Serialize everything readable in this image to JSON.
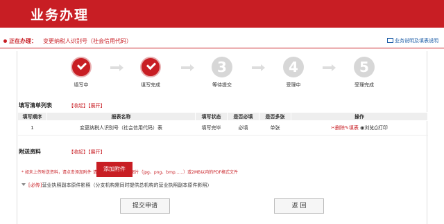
{
  "header": {
    "title": "业务办理"
  },
  "status": {
    "label": "正在办理：",
    "value": "变更纳税人识别号（社会信用代码）",
    "help_link": "业务说明及填表说明"
  },
  "steps": [
    {
      "label": "填写中",
      "state": "done",
      "number": ""
    },
    {
      "label": "填写完成",
      "state": "done",
      "number": ""
    },
    {
      "label": "等待提交",
      "state": "todo",
      "number": "3"
    },
    {
      "label": "受理中",
      "state": "todo",
      "number": "4"
    },
    {
      "label": "受理完成",
      "state": "todo",
      "number": "5"
    }
  ],
  "fill_list": {
    "title": "填写清单列表",
    "collapse": "【收起】",
    "expand": "【展开】",
    "columns": [
      "填写顺序",
      "报表名称",
      "填写状态",
      "是否必填",
      "是否多张",
      "操作"
    ],
    "rows": [
      {
        "order": "1",
        "name": "变更纳税人识别号（社会信用代码）表",
        "status": "填写完毕",
        "required": "必填",
        "multiple": "单张",
        "actions": {
          "delete": "删除",
          "fill": "填表",
          "browse": "浏览",
          "print": "打印"
        }
      }
    ]
  },
  "attachments": {
    "title": "附送资料",
    "collapse": "【收起】",
    "expand": "【展开】",
    "note": "* 如未上传附送资料，请点击添加附件 请上传500kb以内的图片（jpg、png、bmp......）或2MB以内的PDF格式文件",
    "add_button": "添加附件",
    "item_required": "[必传]",
    "item_text": "营业执照副本原件影照（分支机构需同时提供总机构的营业执照副本原件影照）"
  },
  "buttons": {
    "submit": "提交申请",
    "back": "返 回"
  },
  "colors": {
    "brand": "#c81e24",
    "help_link": "#1f5fa8",
    "step_todo": "#d7d7d7"
  }
}
